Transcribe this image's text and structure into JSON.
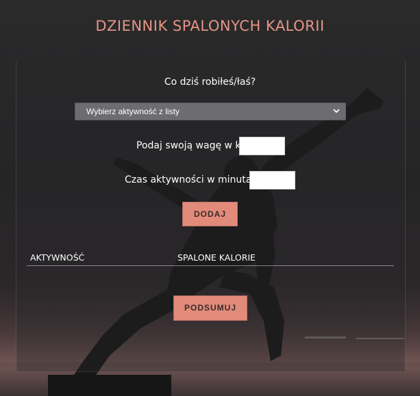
{
  "app": {
    "title": "DZIENNIK SPALONYCH KALORII"
  },
  "form": {
    "question": "Co dziś robiłeś/łaś?",
    "activity_select": {
      "selected": "Wybierz aktywność z listy"
    },
    "weight_label": "Podaj swoją wagę w kg:",
    "weight_value": "",
    "duration_label": "Czas aktywności w minutach:",
    "duration_value": "",
    "add_button": "DODAJ"
  },
  "table": {
    "columns": [
      "AKTYWNOŚĆ",
      "SPALONE KALORIE"
    ],
    "rows": []
  },
  "summary_button": "PODSUMUJ",
  "colors": {
    "accent": "#e28b7b",
    "title": "#e69585",
    "select_bg": "#6d6c70"
  }
}
